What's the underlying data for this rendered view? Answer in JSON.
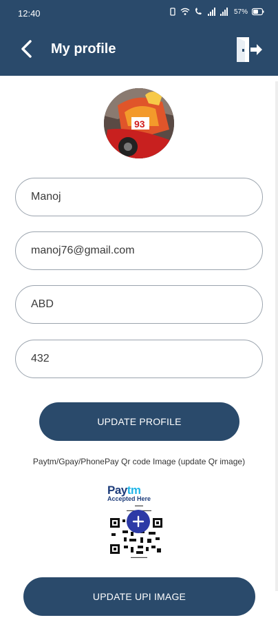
{
  "status_bar": {
    "time": "12:40",
    "battery": "57%"
  },
  "header": {
    "title": "My profile",
    "back_icon": "chevron-left-icon",
    "logout_icon": "logout-icon"
  },
  "profile": {
    "avatar_icon": "profile-photo"
  },
  "form": {
    "name_value": "Manoj",
    "email_value": "manoj76@gmail.com",
    "field3_value": "ABD",
    "field4_value": "432"
  },
  "buttons": {
    "update_profile": "UPDATE PROFILE",
    "update_upi": "UPDATE UPI IMAGE"
  },
  "qr_section": {
    "label": "Paytm/Gpay/PhonePay Qr code Image (update Qr image)",
    "paytm_accepted": "Accepted Here",
    "add_icon": "plus-icon"
  },
  "colors": {
    "primary": "#2a4a6b",
    "fab": "#2d3aa6"
  }
}
